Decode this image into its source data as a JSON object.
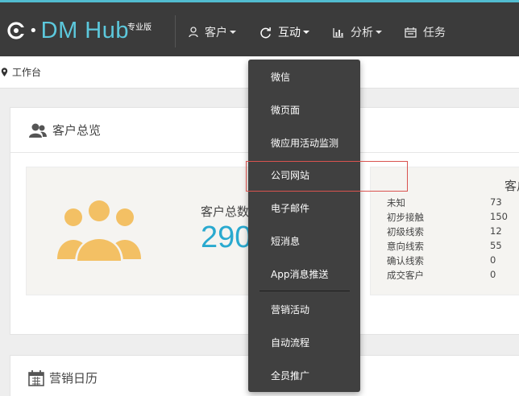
{
  "app": {
    "logo_text": "DM Hub",
    "logo_dot": "•",
    "edition": "专业版"
  },
  "nav": {
    "customer": "客户",
    "interact": "互动",
    "analysis": "分析",
    "tasks": "任务"
  },
  "breadcrumb": {
    "label": "工作台"
  },
  "overview": {
    "title": "客户总览",
    "total_label": "客户总数",
    "total_value": "290",
    "funnel_title": "客户",
    "stages": [
      {
        "name": "未知",
        "count": "73"
      },
      {
        "name": "初步接触",
        "count": "150"
      },
      {
        "name": "初级线索",
        "count": "12"
      },
      {
        "name": "意向线索",
        "count": "55"
      },
      {
        "name": "确认线索",
        "count": "0"
      },
      {
        "name": "成交客户",
        "count": "0"
      }
    ]
  },
  "calendar": {
    "title": "营销日历"
  },
  "dropdown": {
    "items": [
      {
        "label": "微信"
      },
      {
        "label": "微页面"
      },
      {
        "label": "微应用活动监测"
      },
      {
        "label": "公司网站"
      },
      {
        "label": "电子邮件"
      },
      {
        "label": "短消息"
      },
      {
        "label": "App消息推送"
      },
      {
        "label": "营销活动"
      },
      {
        "label": "自动流程"
      },
      {
        "label": "全员推广"
      }
    ]
  },
  "colors": {
    "topbar": "#3b3b3b",
    "accent": "#52bcd0",
    "total_value": "#29a9cf",
    "people_icon": "#f3c064",
    "highlight": "#d9534f"
  }
}
